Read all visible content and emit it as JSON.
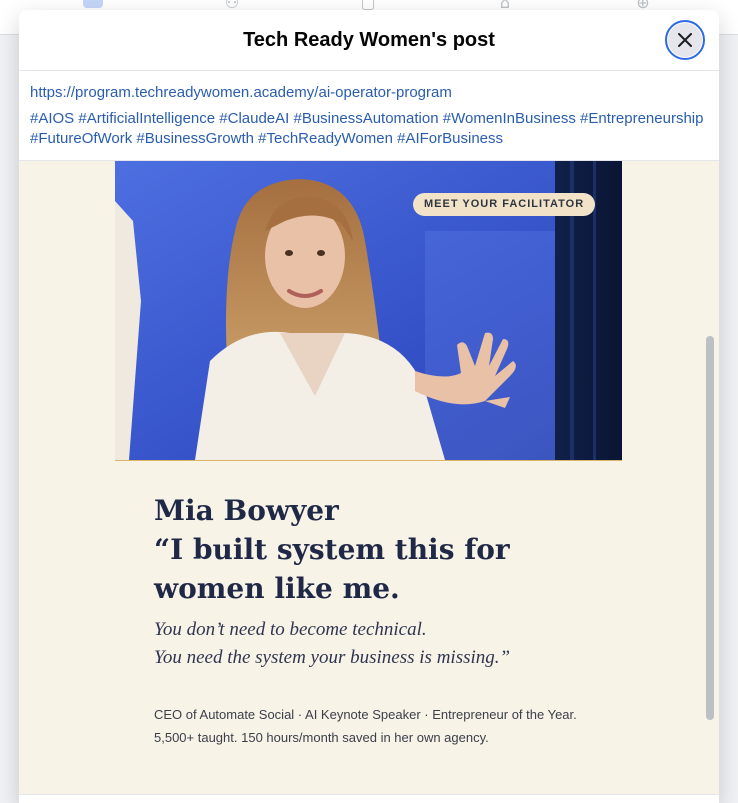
{
  "dialog": {
    "title": "Tech Ready Women's post"
  },
  "post": {
    "link": "https://program.techreadywomen.academy/ai-operator-program",
    "hashtags": [
      "#AIOS",
      "#ArtificialIntelligence",
      "#ClaudeAI",
      "#BusinessAutomation",
      "#WomenInBusiness",
      "#Entrepreneurship",
      "#FutureOfWork",
      "#BusinessGrowth",
      "#TechReadyWomen",
      "#AIForBusiness"
    ]
  },
  "image": {
    "badge": "MEET YOUR FACILITATOR",
    "name": "Mia Bowyer",
    "quote_line1": "“I built system this for",
    "quote_line2": "women like me.",
    "quote_italic1": "You don’t need to become technical.",
    "quote_italic2": "You need the system your business is missing.”",
    "bio_line1": "CEO of Automate Social · AI Keynote Speaker · Entrepreneur of the Year.",
    "bio_line2": "5,500+ taught. 150 hours/month saved in her own agency."
  },
  "icons": {
    "close": "close-icon"
  },
  "colors": {
    "link": "#2a5db0",
    "image_background": "#f8f3e7",
    "heading_navy": "#1f2847",
    "focus_ring": "#2d6ae3"
  }
}
